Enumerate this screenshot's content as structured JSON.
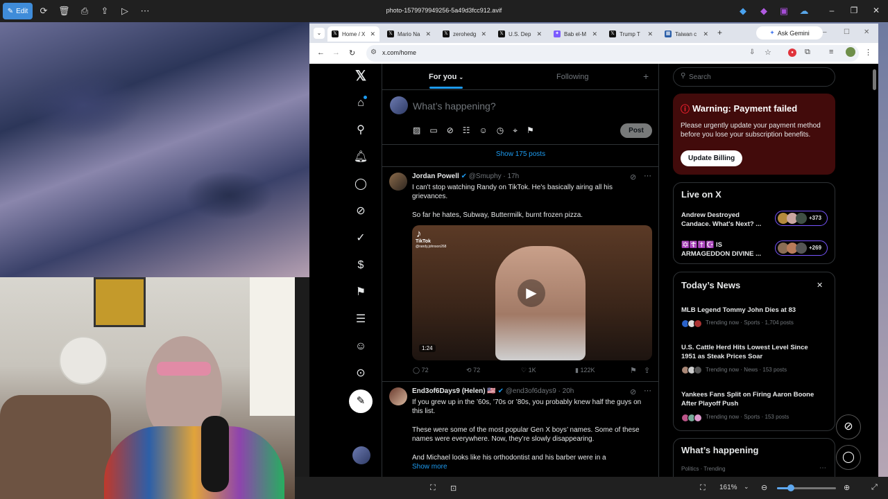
{
  "viewer": {
    "edit_label": "Edit",
    "file_title": "photo-1579979949256-5a49d3fcc912.avif",
    "zoom": "161%"
  },
  "browser": {
    "tabs": [
      {
        "label": "Home / X",
        "active": true
      },
      {
        "label": "Mario Na"
      },
      {
        "label": "zerohedg"
      },
      {
        "label": "U.S. Dep"
      },
      {
        "label": "Bab el-M"
      },
      {
        "label": "Trump T"
      },
      {
        "label": "Taiwan c"
      }
    ],
    "gemini_label": "Ask Gemini",
    "url": "x.com/home"
  },
  "x": {
    "tabs": {
      "for_you": "For you",
      "following": "Following"
    },
    "compose_placeholder": "What’s happening?",
    "post_button": "Post",
    "show_posts": "Show 175 posts",
    "posts": [
      {
        "name": "Jordan Powell",
        "handle": "@Smuphy · 17h",
        "text1": "I can't stop watching Randy on TikTok. He's basically airing all his grievances.",
        "text2": "So far he hates, Subway, Buttermilk, burnt frozen pizza.",
        "video_duration": "1:24",
        "tiktok_label": "TikTok",
        "tiktok_user": "@randy.johnson268",
        "replies": "72",
        "reposts": "72",
        "likes": "1K",
        "views": "122K"
      },
      {
        "name": "End3of6Days9 (Helen)",
        "flag": "🇺🇸",
        "handle": "@end3of6days9 · 20h",
        "text1": "If you grew up in the ’60s, ’70s or ’80s, you probably knew half the guys on this list.",
        "text2": "These were some of the most popular Gen X boys’ names. Some of these names were everywhere. Now, they’re slowly disappearing.",
        "text3": "And Michael looks like his orthodontist and his barber were in a",
        "show_more": "Show more"
      }
    ],
    "search_placeholder": "Search",
    "warning": {
      "title": "Warning: Payment failed",
      "body": "Please urgently update your payment method before you lose your subscription benefits.",
      "button": "Update Billing"
    },
    "live": {
      "title": "Live on X",
      "items": [
        {
          "title": "Andrew Destroyed Candace. What's Next? ...",
          "count": "+373"
        },
        {
          "title": "✡️☦️✝️☪️ IS ARMAGEDDON DIVINE ...",
          "count": "+269"
        }
      ]
    },
    "news": {
      "title": "Today’s News",
      "items": [
        {
          "title": "MLB Legend Tommy John Dies at 83",
          "meta": "Trending now · Sports · 1,704 posts"
        },
        {
          "title": "U.S. Cattle Herd Hits Lowest Level Since 1951 as Steak Prices Soar",
          "meta": "Trending now · News · 153 posts"
        },
        {
          "title": "Yankees Fans Split on Firing Aaron Boone After Playoff Push",
          "meta": "Trending now · Sports · 153 posts"
        }
      ]
    },
    "happening": {
      "title": "What’s happening",
      "meta": "Politics · Trending"
    }
  },
  "colors": {
    "x_blue": "#1d9bf0",
    "warning_bg": "#420b0b",
    "warning_red": "#f4212e",
    "viewer_accent": "#3f8cd9"
  }
}
